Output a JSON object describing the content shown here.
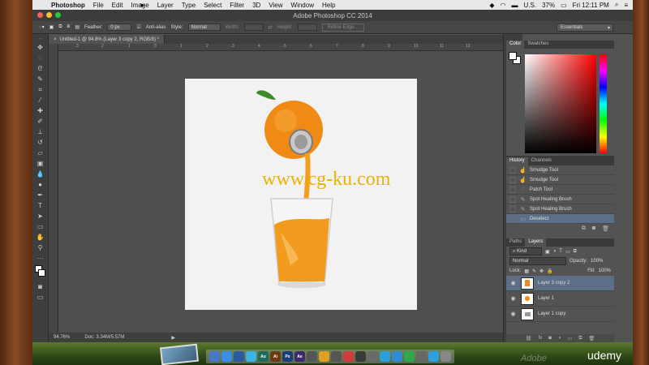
{
  "menubar": {
    "app_name": "Photoshop",
    "items": [
      "File",
      "Edit",
      "Image",
      "Layer",
      "Type",
      "Select",
      "Filter",
      "3D",
      "View",
      "Window",
      "Help"
    ],
    "battery": "37%",
    "locale": "U.S.",
    "clock": "Fri 12:11 PM"
  },
  "window": {
    "title": "Adobe Photoshop CC 2014"
  },
  "options_bar": {
    "feather_label": "Feather:",
    "feather_value": "0 px",
    "anti_alias_label": "Anti-alias",
    "style_label": "Style:",
    "style_value": "Normal",
    "width_label": "Width:",
    "height_label": "Height:",
    "refine_label": "Refine Edge...",
    "workspace": "Essentials"
  },
  "document": {
    "tab_title": "Untitled-1 @ 94.8% (Layer 3 copy 2, RGB/8) *",
    "watermark": "www.cg-ku.com"
  },
  "ruler_labels": [
    "3",
    "2",
    "1",
    "0",
    "1",
    "2",
    "3",
    "4",
    "5",
    "6",
    "7",
    "8",
    "9",
    "10",
    "11",
    "12"
  ],
  "status": {
    "zoom": "94.76%",
    "doc_size": "Doc: 3.34M/5.57M"
  },
  "color_panel": {
    "tabs": [
      "Color",
      "Swatches"
    ]
  },
  "history_panel": {
    "tabs": [
      "History",
      "Channels"
    ],
    "items": [
      {
        "label": "Smudge Tool",
        "selected": false
      },
      {
        "label": "Smudge Tool",
        "selected": false
      },
      {
        "label": "Patch Tool",
        "selected": false
      },
      {
        "label": "Spot Healing Brush",
        "selected": false
      },
      {
        "label": "Spot Healing Brush",
        "selected": false
      },
      {
        "label": "Deselect",
        "selected": true
      }
    ]
  },
  "layers_panel": {
    "tabs": [
      "Paths",
      "Layers"
    ],
    "kind_label": "Kind",
    "blend_mode": "Normal",
    "opacity_label": "Opacity:",
    "opacity_value": "100%",
    "lock_label": "Lock:",
    "fill_label": "Fill:",
    "fill_value": "100%",
    "layers": [
      {
        "name": "Layer 3 copy 2",
        "selected": true
      },
      {
        "name": "Layer 1",
        "selected": false
      },
      {
        "name": "Layer 1 copy",
        "selected": false
      }
    ]
  },
  "dock": {
    "apps": [
      {
        "label": "",
        "color": "#4a78c9"
      },
      {
        "label": "",
        "color": "#3a8ee6"
      },
      {
        "label": "",
        "color": "#2c5aa0"
      },
      {
        "label": "",
        "color": "#3bb5e8"
      },
      {
        "label": "Au",
        "color": "#1f6b5a"
      },
      {
        "label": "Ai",
        "color": "#6b3b12"
      },
      {
        "label": "Ps",
        "color": "#1b3e78"
      },
      {
        "label": "Ae",
        "color": "#3d2a6b"
      },
      {
        "label": "",
        "color": "#555555"
      },
      {
        "label": "",
        "color": "#e0a020"
      },
      {
        "label": "",
        "color": "#555555"
      },
      {
        "label": "",
        "color": "#d23b3b"
      },
      {
        "label": "",
        "color": "#3a3a3a"
      },
      {
        "label": "",
        "color": "#6a6a6a"
      },
      {
        "label": "",
        "color": "#2aa0d8"
      },
      {
        "label": "",
        "color": "#2d8cd2"
      },
      {
        "label": "",
        "color": "#2fa84a"
      },
      {
        "label": "",
        "color": "#666666"
      },
      {
        "label": "",
        "color": "#2c9fe0"
      },
      {
        "label": "",
        "color": "#888888"
      }
    ]
  },
  "branding": {
    "udemy": "udemy"
  }
}
